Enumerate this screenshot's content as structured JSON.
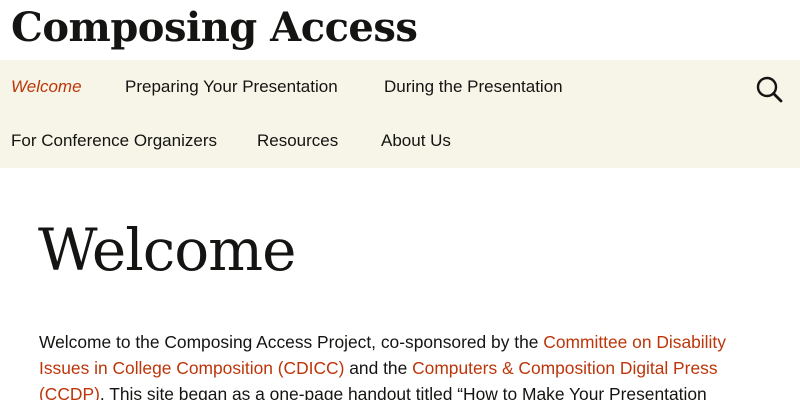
{
  "site": {
    "title": "Composing Access"
  },
  "nav": {
    "items": [
      {
        "label": "Welcome",
        "current": true
      },
      {
        "label": "Preparing Your Presentation"
      },
      {
        "label": "During the Presentation"
      },
      {
        "label": "For Conference Organizers"
      },
      {
        "label": "Resources"
      },
      {
        "label": "About Us"
      }
    ],
    "search_icon": "search-icon"
  },
  "page": {
    "title": "Welcome",
    "intro": {
      "text_1": "Welcome to the Composing Access Project, co-sponsored by the ",
      "link_1": "Committee on Disability Issues in College Composition (CDICC)",
      "text_2": " and the ",
      "link_2": "Computers & Composition Digital Press (CCDP)",
      "text_3": ". This site began as a one-page handout titled “How to Make Your Presentation"
    }
  },
  "colors": {
    "nav_background": "#f7f5e7",
    "link": "#bc360a",
    "text": "#141412"
  }
}
